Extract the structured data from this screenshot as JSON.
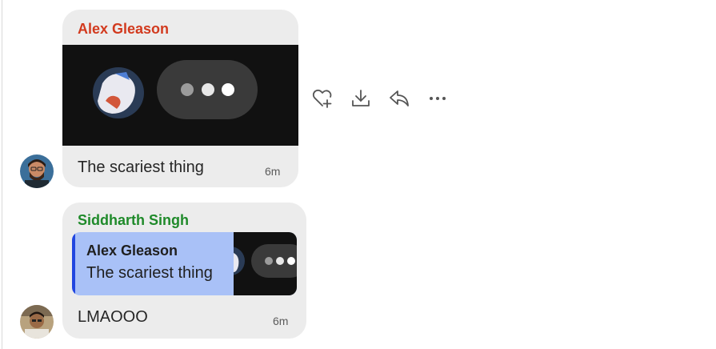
{
  "messages": [
    {
      "sender": "Alex Gleason",
      "sender_color": "#d23a1e",
      "text": "The scariest thing",
      "time": "6m"
    },
    {
      "sender": "Siddharth Singh",
      "sender_color": "#1f8a2a",
      "reply_to": {
        "sender": "Alex Gleason",
        "text": "The scariest thing"
      },
      "text": "LMAOOO",
      "time": "6m"
    }
  ],
  "actions": [
    {
      "icon": "heart-plus-icon",
      "label": "React"
    },
    {
      "icon": "download-icon",
      "label": "Download"
    },
    {
      "icon": "reply-icon",
      "label": "Reply"
    },
    {
      "icon": "more-icon",
      "label": "More"
    }
  ],
  "colors": {
    "bubble": "#ececec",
    "quote_bg": "#a9c1f7",
    "quote_accent": "#2146e0"
  }
}
